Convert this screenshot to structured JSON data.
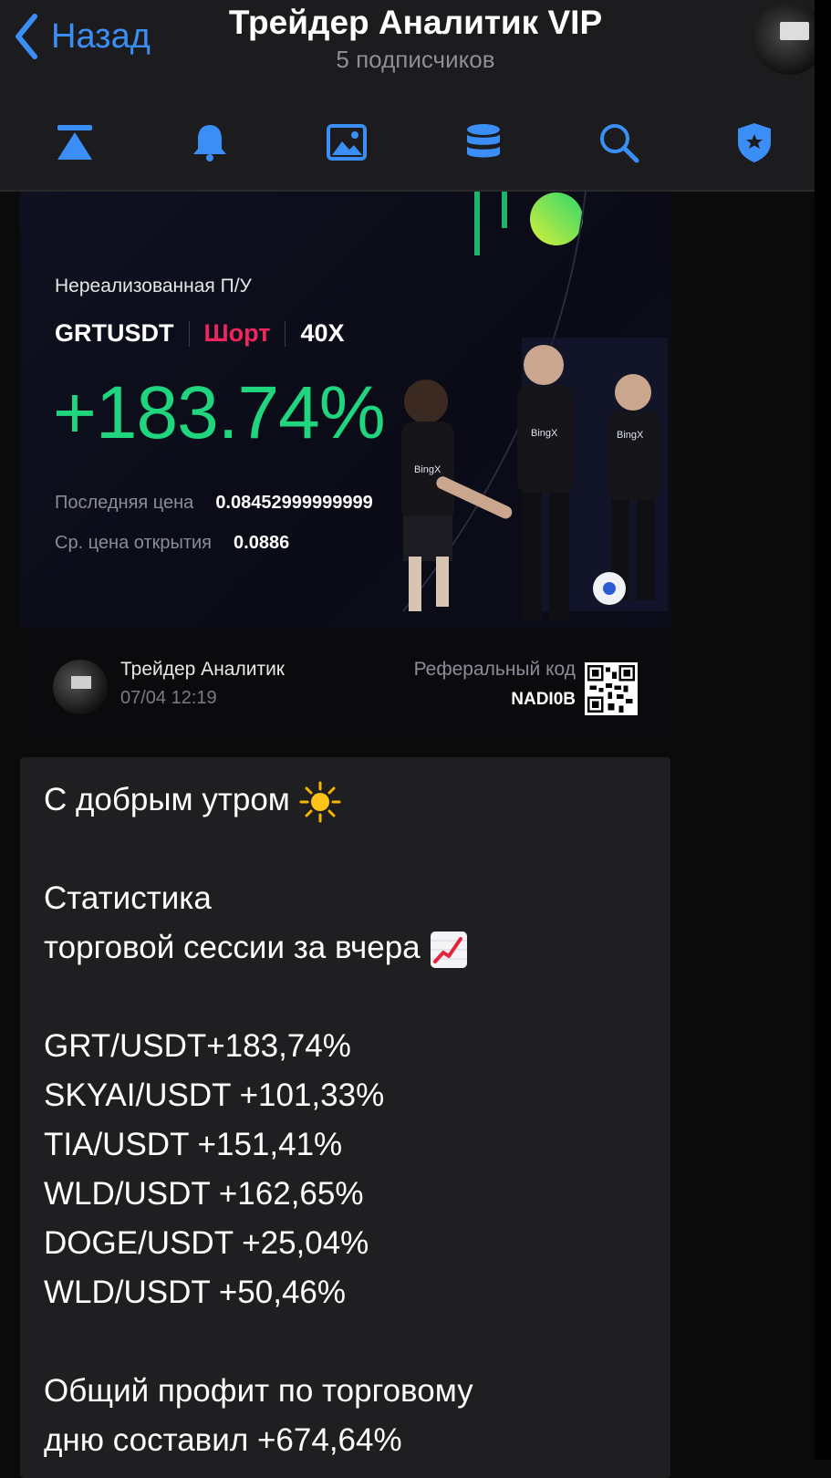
{
  "header": {
    "back_label": "Назад",
    "title": "Трейдер Аналитик VIP",
    "subtitle": "5 подписчиков",
    "toolbar_icons": [
      "pin-icon",
      "bell-icon",
      "photo-icon",
      "database-icon",
      "search-icon",
      "shield-icon"
    ],
    "accent_color": "#3a8ef6"
  },
  "card": {
    "label": "Нереализованная П/У",
    "pair": "GRTUSDT",
    "side": "Шорт",
    "leverage": "40X",
    "pnl": "+183.74%",
    "last_price_label": "Последняя цена",
    "last_price": "0.08452999999999",
    "open_price_label": "Ср. цена открытия",
    "open_price": "0.0886",
    "brand": "BingX",
    "pnl_color": "#1fd67f",
    "side_color": "#f0245e"
  },
  "footer": {
    "author": "Трейдер Аналитик",
    "date": "07/04 12:19",
    "ref_label": "Реферальный код",
    "ref_code": "NADI0B"
  },
  "message": {
    "greeting": "С добрым утром",
    "stats_title_1": "Статистика",
    "stats_title_2": "торговой сессии за вчера",
    "trades": [
      "GRT/USDT+183,74%",
      "SKYAI/USDT +101,33%",
      "TIA/USDT +151,41%",
      "WLD/USDT +162,65%",
      "DOGE/USDT +25,04%",
      "WLD/USDT +50,46%"
    ],
    "summary_1": "Общий профит по торговому",
    "summary_2": "дню составил +674,64%"
  }
}
